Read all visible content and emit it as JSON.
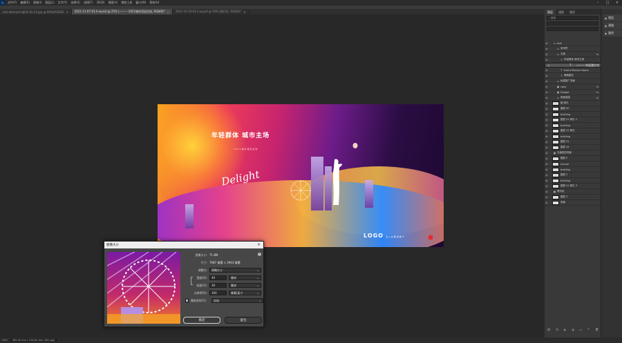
{
  "menu": {
    "app_icon": "Ps",
    "items": [
      "文件(F)",
      "编辑(E)",
      "图像(I)",
      "图层(L)",
      "文字(Y)",
      "选择(S)",
      "滤镜(T)",
      "3D(D)",
      "视图(V)",
      "增效工具",
      "窗口(W)",
      "帮助(H)"
    ]
  },
  "tabs": [
    {
      "label": "ahs-abstract-lights-5k k3.jpg @ 99%(RGB/8)",
      "active": false
    },
    {
      "label": "2021-11-07-01-h-w.psd @ 25% (——— 2021城市活动方向, RGB/8)*",
      "active": true
    },
    {
      "label": "2021-10-10-01-h-w.psd @ 50% (图片拉, RGB/8)*",
      "active": false
    }
  ],
  "canvas": {
    "headline": "年轻群体 城市主场",
    "sub": "2 0 2 1 城 市 潮 流 活 动",
    "script_text": "Delight",
    "logo": "LOGO",
    "logo_text": "五 公 比 都 美 朋 ℃"
  },
  "layers_panel": {
    "tabs": [
      "图层",
      "通道",
      "路径"
    ],
    "search_placeholder": "类型",
    "rows": [
      {
        "name": "text",
        "indent": 1,
        "type": "folder",
        "fx": false
      },
      {
        "name": "系列符",
        "indent": 2,
        "type": "folder",
        "fx": false
      },
      {
        "name": "文案",
        "indent": 2,
        "type": "folder",
        "fx": true
      },
      {
        "name": "年轻群体 城市主场",
        "indent": 3,
        "type": "text",
        "fx": false
      },
      {
        "name": "——— 年轻潮力节",
        "indent": 3,
        "type": "text",
        "fx": false,
        "selected": true
      },
      {
        "name": "Event Mission Name",
        "indent": 3,
        "type": "text",
        "fx": false
      },
      {
        "name": "潮地图文",
        "indent": 3,
        "type": "text",
        "fx": false
      },
      {
        "name": "私属推广背景",
        "indent": 2,
        "type": "folder",
        "fx": false
      },
      {
        "name": "cake",
        "indent": 2,
        "type": "smart",
        "fx": true
      },
      {
        "name": "Delight",
        "indent": 2,
        "type": "smart",
        "fx": true
      },
      {
        "name": "夜景渲染",
        "indent": 2,
        "type": "folder",
        "fx": true
      },
      {
        "name": "图 拷贝",
        "indent": 1,
        "type": "image",
        "fx": false
      },
      {
        "name": "图层 40",
        "indent": 1,
        "type": "image",
        "fx": false
      },
      {
        "name": "building",
        "indent": 1,
        "type": "image",
        "fx": false
      },
      {
        "name": "图层 41 拷贝 2",
        "indent": 1,
        "type": "image",
        "fx": false
      },
      {
        "name": "building",
        "indent": 1,
        "type": "image",
        "fx": false
      },
      {
        "name": "图层 41 拷贝",
        "indent": 1,
        "type": "image",
        "fx": false
      },
      {
        "name": "building",
        "indent": 1,
        "type": "image",
        "fx": false
      },
      {
        "name": "图层 41",
        "indent": 1,
        "type": "image",
        "fx": false
      },
      {
        "name": "图层 44",
        "indent": 1,
        "type": "image",
        "fx": false
      },
      {
        "name": "天幕弧形背景",
        "indent": 1,
        "type": "smart",
        "fx": false
      },
      {
        "name": "图层 5",
        "indent": 1,
        "type": "image",
        "fx": false
      },
      {
        "name": "human",
        "indent": 1,
        "type": "image",
        "fx": false
      },
      {
        "name": "building",
        "indent": 1,
        "type": "image",
        "fx": false
      },
      {
        "name": "图层 2",
        "indent": 1,
        "type": "image",
        "fx": false
      },
      {
        "name": "building",
        "indent": 1,
        "type": "image",
        "fx": false
      },
      {
        "name": "图层 41 拷贝 3",
        "indent": 1,
        "type": "image",
        "fx": false
      },
      {
        "name": "摩天轮",
        "indent": 1,
        "type": "smart",
        "fx": false
      },
      {
        "name": "图层 3",
        "indent": 1,
        "type": "image",
        "fx": false
      },
      {
        "name": "背景",
        "indent": 1,
        "type": "image",
        "fx": false
      }
    ]
  },
  "right_dock": [
    "图层",
    "通道",
    "路径"
  ],
  "status": {
    "zoom": "25%",
    "doc": "500.00 mm x 250.00 mm (300 ppi)"
  },
  "dialog": {
    "title": "图像大小",
    "size_label": "图像大小:",
    "size_value": "71.8M",
    "dims_label": "尺寸:",
    "dims_value": "7087 像素 × 2943 像素",
    "fit_label": "调整为:",
    "fit_value": "原稿大小",
    "width_label": "宽度(D):",
    "width_value": "40",
    "width_unit": "厘米",
    "height_label": "高度(G):",
    "height_value": "30",
    "height_unit": "厘米",
    "res_label": "分辨率(R):",
    "res_value": "300",
    "res_unit": "像素/英寸",
    "resample_label": "重新采样(S):",
    "resample_value": "自动",
    "ok_label": "确定",
    "cancel_label": "复位"
  }
}
